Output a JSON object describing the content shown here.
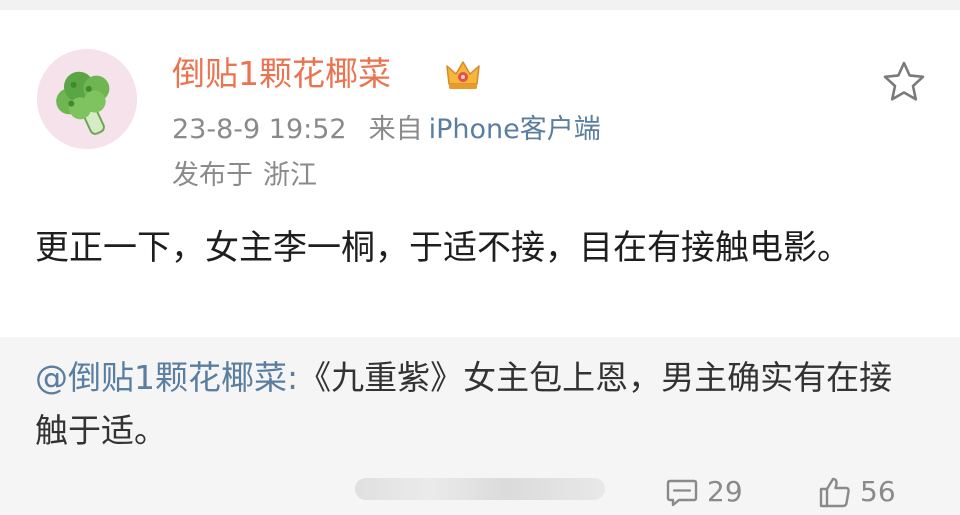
{
  "post": {
    "username": "倒贴1颗花椰菜",
    "timestamp": "23-8-9 19:52",
    "from_label": "来自",
    "source": "iPhone客户端",
    "location_label": "发布于",
    "location": "浙江",
    "text": "更正一下，女主李一桐，于适不接，目在有接触电影。"
  },
  "repost": {
    "mention": "@倒贴1颗花椰菜:",
    "text": "《九重紫》女主包上恩，男主确实有在接触于适。"
  },
  "actions": {
    "comments": "29",
    "likes": "56"
  },
  "icons": {
    "avatar": "broccoli-avatar",
    "badge": "vip-crown-icon",
    "star": "star-outline-icon",
    "comment": "comment-icon",
    "like": "thumbs-up-icon"
  },
  "colors": {
    "username": "#eb7350",
    "link": "#5a7ea0",
    "meta": "#8a8a8a",
    "repost_bg": "#f5f5f5"
  }
}
